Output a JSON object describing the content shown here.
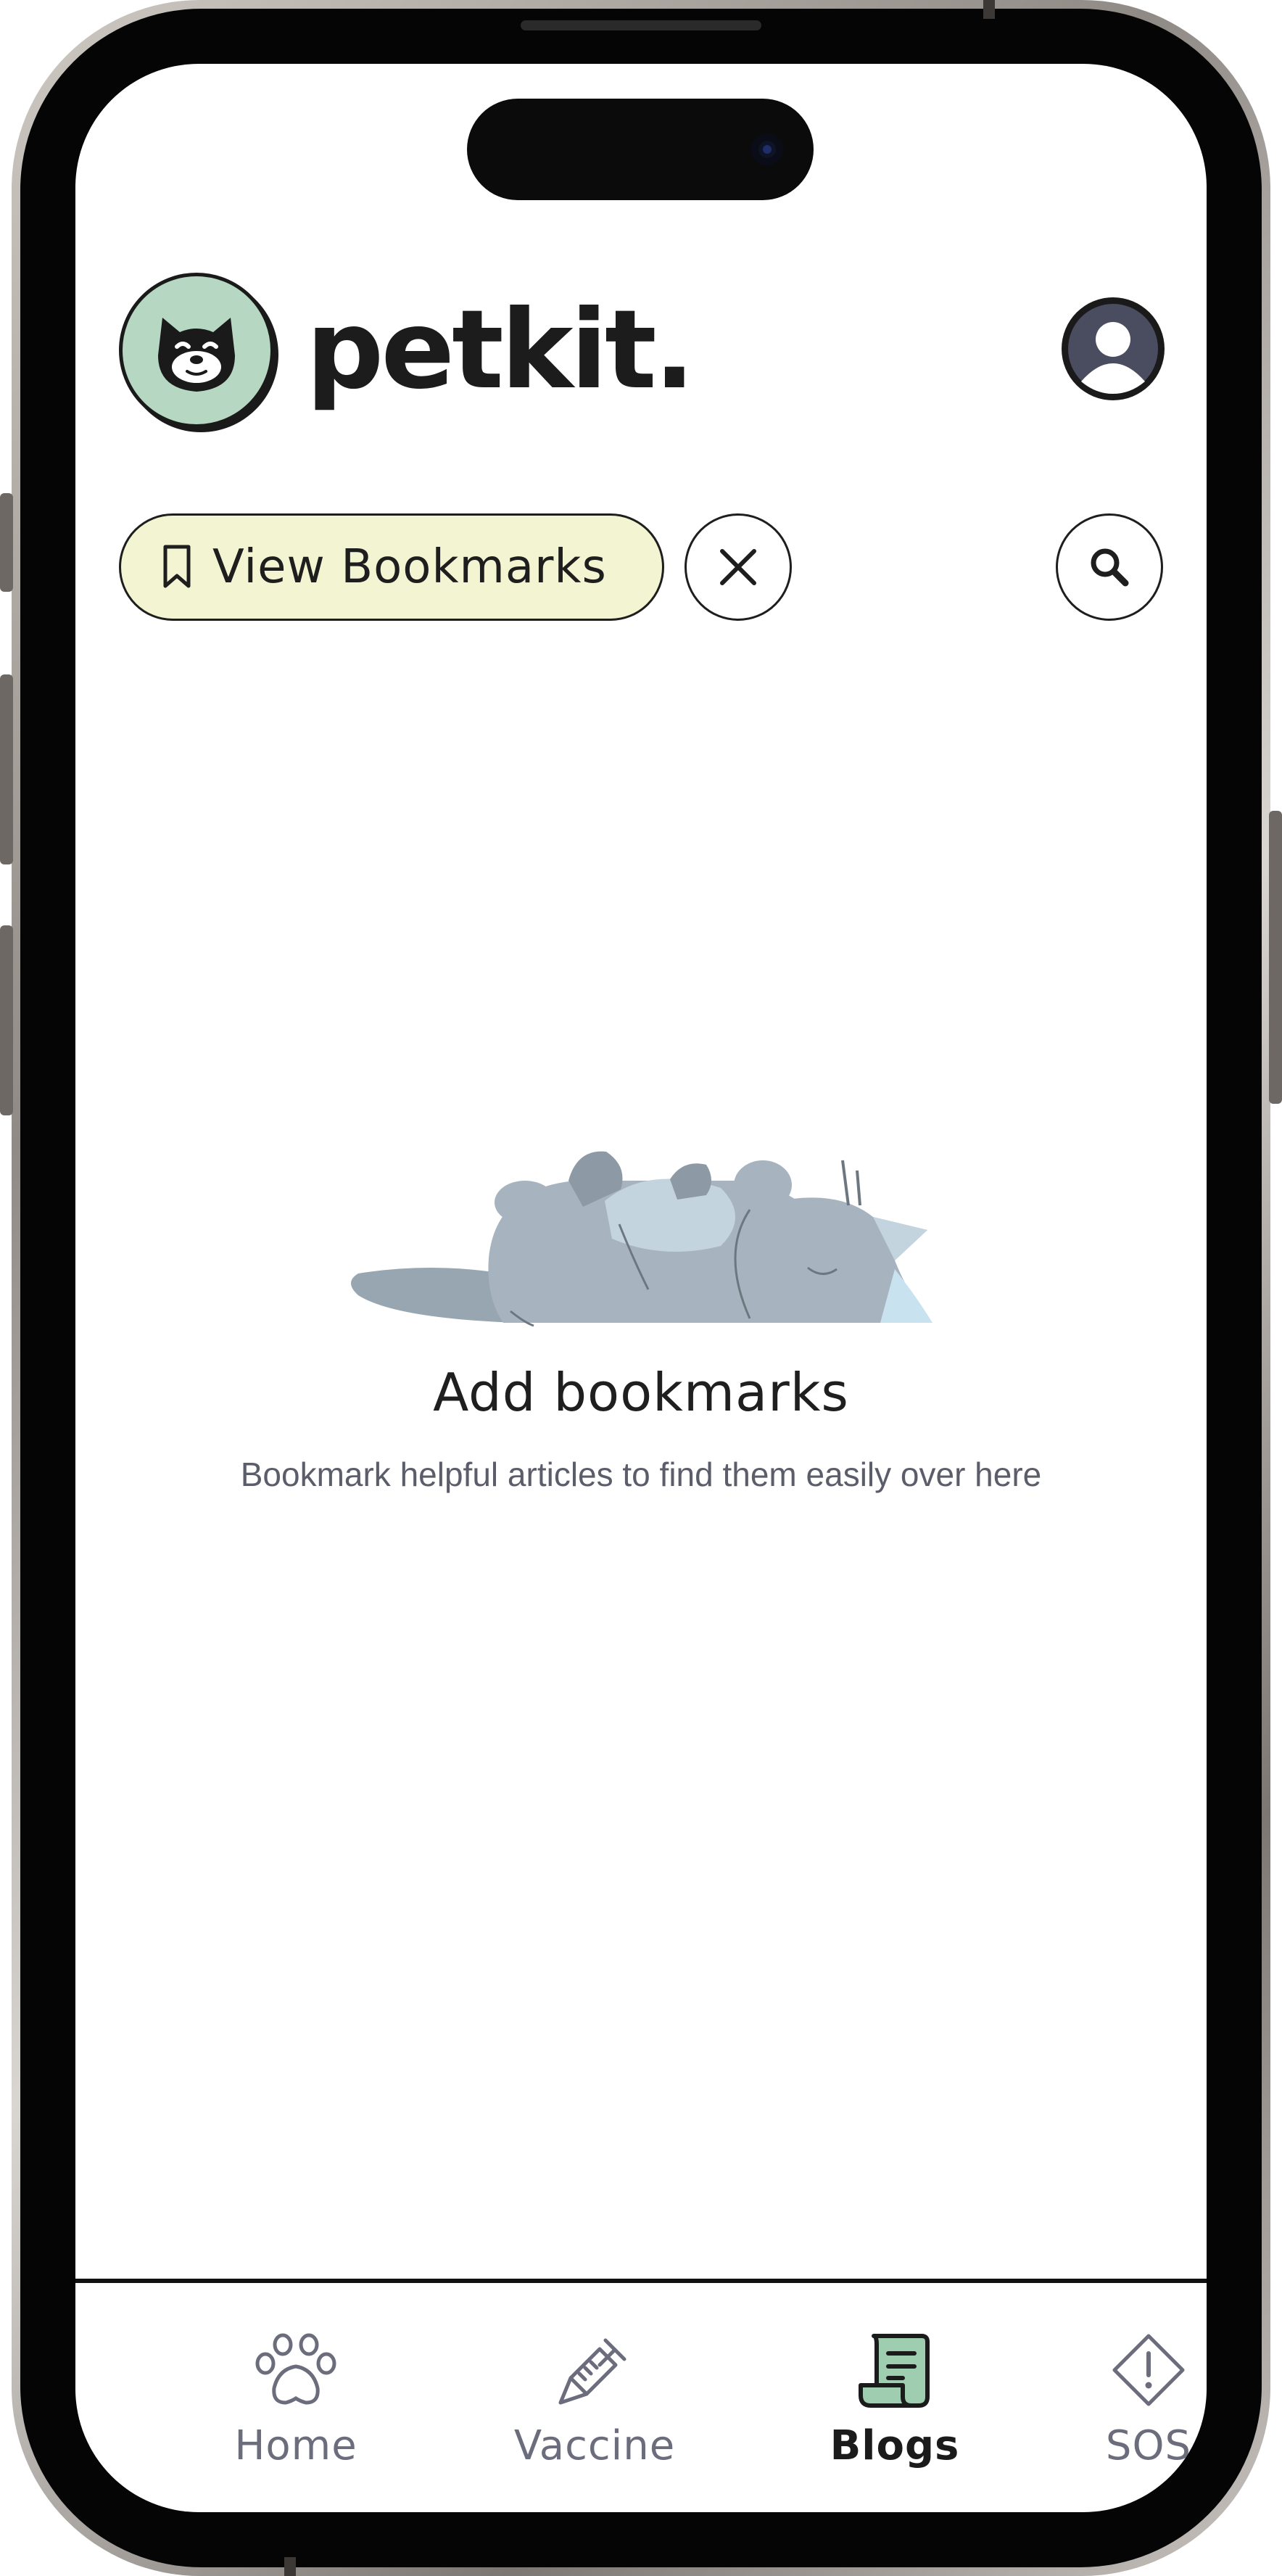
{
  "app": {
    "brand_name": "petkit."
  },
  "header": {
    "profile_icon": "user-circle-icon",
    "logo_icon": "cat-face-icon"
  },
  "filters": {
    "bookmarks_chip_label": "View Bookmarks",
    "bookmark_icon": "bookmark-icon",
    "clear_icon": "close-icon",
    "search_icon": "search-icon"
  },
  "empty_state": {
    "illustration": "sleeping-cat-illustration",
    "title": "Add bookmarks",
    "subtitle": "Bookmark helpful articles to find them easily over here"
  },
  "bottom_nav": {
    "items": [
      {
        "label": "Home",
        "icon": "paw-icon",
        "active": false
      },
      {
        "label": "Vaccine",
        "icon": "syringe-icon",
        "active": false
      },
      {
        "label": "Blogs",
        "icon": "scroll-icon",
        "active": true
      },
      {
        "label": "SOS",
        "icon": "alert-diamond-icon",
        "active": false
      }
    ]
  },
  "colors": {
    "chip_background": "#f3f4d1",
    "logo_background": "#b6d8c2",
    "blogs_icon_fill": "#9fcdb0",
    "inactive_nav": "#6b6d7d",
    "illustration_gray": "#a7b4bf"
  }
}
